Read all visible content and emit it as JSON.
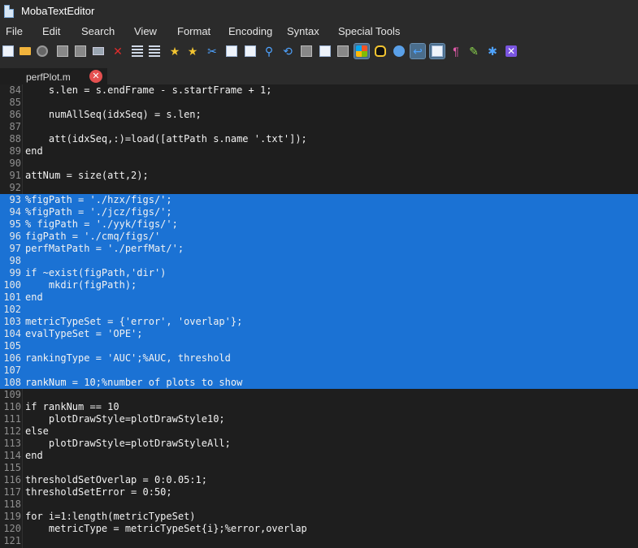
{
  "app": {
    "title": "MobaTextEditor"
  },
  "menu": {
    "items": [
      "File",
      "Edit",
      "Search",
      "View",
      "Format",
      "Encoding",
      "Syntax",
      "Special Tools"
    ]
  },
  "toolbar": {
    "icons": [
      {
        "name": "new-file-icon",
        "shape": "doc"
      },
      {
        "name": "open-folder-icon",
        "shape": "folder"
      },
      {
        "name": "reload-icon",
        "shape": "circle"
      },
      {
        "name": "save-icon",
        "shape": "box"
      },
      {
        "name": "save-all-icon",
        "shape": "box"
      },
      {
        "name": "print-icon",
        "shape": "printer"
      },
      {
        "name": "close-file-icon",
        "shape": "xmark",
        "glyph": "✕",
        "color": "#e02c2c"
      },
      {
        "name": "outdent-icon",
        "shape": "lines"
      },
      {
        "name": "indent-icon",
        "shape": "lines"
      },
      {
        "name": "bookmark-toggle-icon",
        "shape": "glyph",
        "glyph": "★",
        "color": "#f2c431"
      },
      {
        "name": "bookmark-next-icon",
        "shape": "glyph",
        "glyph": "★",
        "color": "#f2c431"
      },
      {
        "name": "cut-icon",
        "shape": "glyph",
        "glyph": "✂",
        "color": "#4fa3ff"
      },
      {
        "name": "copy-icon",
        "shape": "doc"
      },
      {
        "name": "paste-icon",
        "shape": "doc"
      },
      {
        "name": "find-icon",
        "shape": "glyph",
        "glyph": "⚲",
        "color": "#4fa3ff"
      },
      {
        "name": "replace-icon",
        "shape": "glyph",
        "glyph": "⟲",
        "color": "#4fa3ff"
      },
      {
        "name": "macro-icon",
        "shape": "box"
      },
      {
        "name": "compare-icon",
        "shape": "doc"
      },
      {
        "name": "split-view-icon",
        "shape": "box"
      },
      {
        "name": "windows-eol-icon",
        "shape": "win",
        "selected": true
      },
      {
        "name": "linux-eol-icon",
        "shape": "tux"
      },
      {
        "name": "mac-eol-icon",
        "shape": "apple"
      },
      {
        "name": "word-wrap-icon",
        "shape": "glyph",
        "glyph": "↩",
        "color": "#4fa3ff",
        "selected": true
      },
      {
        "name": "show-whitespace-icon",
        "shape": "doc",
        "selected": true
      },
      {
        "name": "pilcrow-icon",
        "shape": "glyph",
        "glyph": "¶",
        "color": "#e05aa8"
      },
      {
        "name": "highlighter-icon",
        "shape": "glyph",
        "glyph": "✎",
        "color": "#8bd34d"
      },
      {
        "name": "settings-icon",
        "shape": "glyph",
        "glyph": "✱",
        "color": "#4fa3ff"
      },
      {
        "name": "exit-icon",
        "shape": "purple",
        "glyph": "✕"
      }
    ]
  },
  "tabs": [
    {
      "label": "perfPlot.m",
      "close": "✕"
    }
  ],
  "editor": {
    "selection_color": "#1b72d4",
    "lines": [
      {
        "n": "84",
        "text": "    s.len = s.endFrame - s.startFrame + 1;",
        "sel": false
      },
      {
        "n": "85",
        "text": "",
        "sel": false
      },
      {
        "n": "86",
        "text": "    numAllSeq(idxSeq) = s.len;",
        "sel": false
      },
      {
        "n": "87",
        "text": "",
        "sel": false
      },
      {
        "n": "88",
        "text": "    att(idxSeq,:)=load([attPath s.name '.txt']);",
        "sel": false
      },
      {
        "n": "89",
        "text": "end",
        "sel": false
      },
      {
        "n": "90",
        "text": "",
        "sel": false
      },
      {
        "n": "91",
        "text": "attNum = size(att,2);",
        "sel": false
      },
      {
        "n": "92",
        "text": "",
        "sel": false
      },
      {
        "n": "93",
        "text": "%figPath = './hzx/figs/';",
        "sel": true
      },
      {
        "n": "94",
        "text": "%figPath = './jcz/figs/';",
        "sel": true
      },
      {
        "n": "95",
        "text": "% figPath = './yyk/figs/';",
        "sel": true
      },
      {
        "n": "96",
        "text": "figPath = './cmq/figs/'",
        "sel": true
      },
      {
        "n": "97",
        "text": "perfMatPath = './perfMat/';",
        "sel": true
      },
      {
        "n": "98",
        "text": "",
        "sel": true
      },
      {
        "n": "99",
        "text": "if ~exist(figPath,'dir')",
        "sel": true
      },
      {
        "n": "100",
        "text": "    mkdir(figPath);",
        "sel": true
      },
      {
        "n": "101",
        "text": "end",
        "sel": true
      },
      {
        "n": "102",
        "text": "",
        "sel": true
      },
      {
        "n": "103",
        "text": "metricTypeSet = {'error', 'overlap'};",
        "sel": true
      },
      {
        "n": "104",
        "text": "evalTypeSet = 'OPE';",
        "sel": true
      },
      {
        "n": "105",
        "text": "",
        "sel": true
      },
      {
        "n": "106",
        "text": "rankingType = 'AUC';%AUC, threshold",
        "sel": true
      },
      {
        "n": "107",
        "text": "",
        "sel": true
      },
      {
        "n": "108",
        "text": "rankNum = 10;%number of plots to show",
        "sel": true
      },
      {
        "n": "109",
        "text": "",
        "sel": false
      },
      {
        "n": "110",
        "text": "if rankNum == 10",
        "sel": false
      },
      {
        "n": "111",
        "text": "    plotDrawStyle=plotDrawStyle10;",
        "sel": false
      },
      {
        "n": "112",
        "text": "else",
        "sel": false
      },
      {
        "n": "113",
        "text": "    plotDrawStyle=plotDrawStyleAll;",
        "sel": false
      },
      {
        "n": "114",
        "text": "end",
        "sel": false
      },
      {
        "n": "115",
        "text": "",
        "sel": false
      },
      {
        "n": "116",
        "text": "thresholdSetOverlap = 0:0.05:1;",
        "sel": false
      },
      {
        "n": "117",
        "text": "thresholdSetError = 0:50;",
        "sel": false
      },
      {
        "n": "118",
        "text": "",
        "sel": false
      },
      {
        "n": "119",
        "text": "for i=1:length(metricTypeSet)",
        "sel": false
      },
      {
        "n": "120",
        "text": "    metricType = metricTypeSet{i};%error,overlap",
        "sel": false
      },
      {
        "n": "121",
        "text": "",
        "sel": false
      }
    ]
  }
}
